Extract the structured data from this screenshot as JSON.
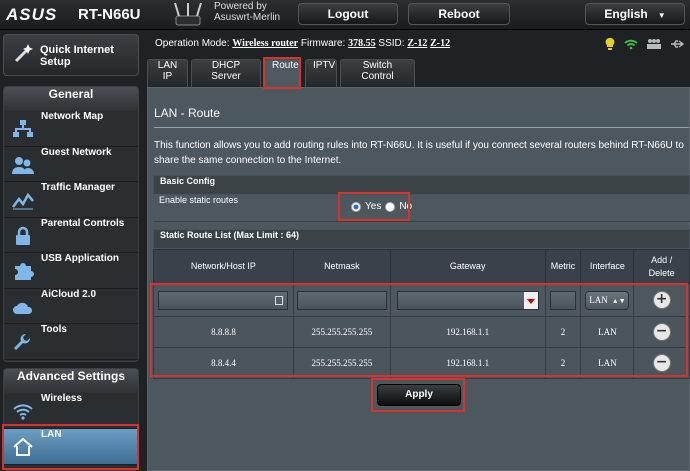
{
  "header": {
    "brand": "ASUS",
    "model": "RT-N66U",
    "powered_by_line1": "Powered by",
    "powered_by_line2": "Asuswrt-Merlin",
    "logout_label": "Logout",
    "reboot_label": "Reboot",
    "language_label": "English"
  },
  "sidebar": {
    "quick_setup_line1": "Quick Internet",
    "quick_setup_line2": "Setup",
    "general_title": "General",
    "general_items": [
      {
        "label": "Network Map",
        "icon": "network-map-icon"
      },
      {
        "label": "Guest Network",
        "icon": "guest-network-icon"
      },
      {
        "label": "Traffic Manager",
        "icon": "traffic-manager-icon"
      },
      {
        "label": "Parental Controls",
        "icon": "lock-icon"
      },
      {
        "label": "USB Application",
        "icon": "puzzle-icon"
      },
      {
        "label": "AiCloud 2.0",
        "icon": "cloud-icon"
      },
      {
        "label": "Tools",
        "icon": "wrench-icon"
      }
    ],
    "advanced_title": "Advanced Settings",
    "advanced_items": [
      {
        "label": "Wireless",
        "icon": "wifi-icon"
      },
      {
        "label": "LAN",
        "icon": "home-icon",
        "active": true
      }
    ]
  },
  "status": {
    "op_mode_label": "Operation Mode:",
    "op_mode_value": "Wireless router",
    "firmware_label": "Firmware:",
    "firmware_value": "378.55",
    "ssid_label": "SSID:",
    "ssid_value1": "Z-12",
    "ssid_value2": "Z-12"
  },
  "tabs": [
    {
      "label": "LAN IP"
    },
    {
      "label": "DHCP Server"
    },
    {
      "label": "Route",
      "active": true
    },
    {
      "label": "IPTV"
    },
    {
      "label": "Switch Control"
    }
  ],
  "page": {
    "title": "LAN - Route",
    "description": "This function allows you to add routing rules into RT-N66U. It is useful if you connect several routers behind RT-N66U to share the same connection to the Internet.",
    "basic_config_title": "Basic Config",
    "static_routes_label": "Enable static routes",
    "radio_yes": "Yes",
    "radio_no": "No",
    "static_routes_selected": "Yes",
    "route_list_title": "Static Route List (Max Limit : 64)",
    "apply_label": "Apply"
  },
  "route_table": {
    "headers": [
      "Network/Host IP",
      "Netmask",
      "Gateway",
      "Metric",
      "Interface",
      "Add /",
      "Delete"
    ],
    "interface_default": "LAN",
    "rows": [
      {
        "ip": "8.8.8.8",
        "netmask": "255.255.255.255",
        "gateway": "192.168.1.1",
        "metric": "2",
        "interface": "LAN"
      },
      {
        "ip": "8.8.4.4",
        "netmask": "255.255.255.255",
        "gateway": "192.168.1.1",
        "metric": "2",
        "interface": "LAN"
      }
    ]
  },
  "colors": {
    "highlight": "#d9312e",
    "active_menu": "#5a8fb6",
    "panel": "#4d585e"
  }
}
